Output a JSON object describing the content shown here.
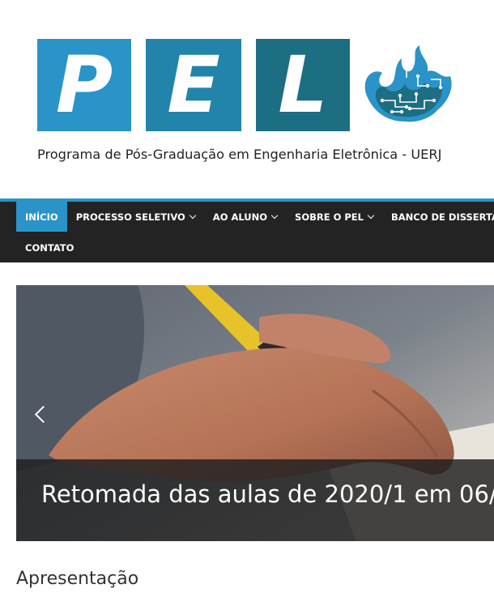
{
  "logo": {
    "letters": [
      "P",
      "E",
      "L"
    ],
    "tagline": "Programa de Pós-Graduação em Engenharia Eletrônica - UERJ",
    "colors": [
      "#2a93c7",
      "#2384ab",
      "#1d6e83"
    ]
  },
  "nav": {
    "items": [
      {
        "label": "INÍCIO",
        "active": true,
        "dropdown": false
      },
      {
        "label": "PROCESSO SELETIVO",
        "active": false,
        "dropdown": true
      },
      {
        "label": "AO ALUNO",
        "active": false,
        "dropdown": true
      },
      {
        "label": "SOBRE O PEL",
        "active": false,
        "dropdown": true
      },
      {
        "label": "BANCO DE DISSERTAÇÕES",
        "active": false,
        "dropdown": false
      },
      {
        "label": "CONTATO",
        "active": false,
        "dropdown": false
      }
    ],
    "accent": "#2a93c7",
    "background": "#232323"
  },
  "slider": {
    "caption": "Retomada das aulas de 2020/1 em 06/"
  },
  "content": {
    "section_title": "Apresentação"
  }
}
